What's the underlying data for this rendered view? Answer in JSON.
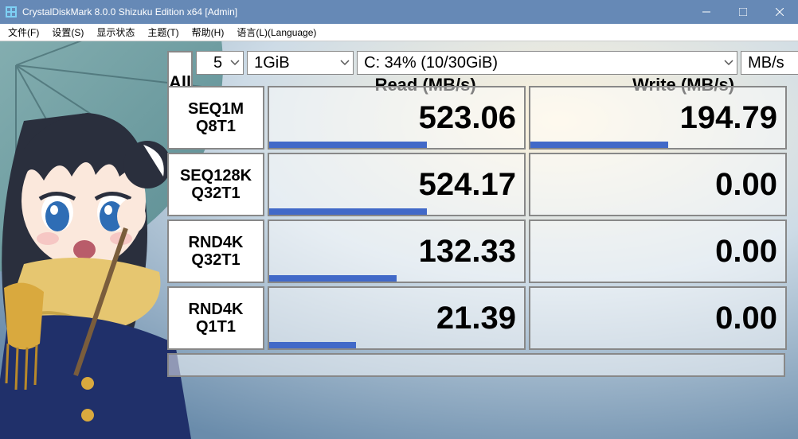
{
  "window": {
    "title": "CrystalDiskMark 8.0.0 Shizuku Edition x64 [Admin]"
  },
  "menu": {
    "file": "文件(F)",
    "settings": "设置(S)",
    "view": "显示状态",
    "theme": "主题(T)",
    "help": "帮助(H)",
    "language": "语言(L)(Language)"
  },
  "controls": {
    "all": "All",
    "count": "5",
    "size": "1GiB",
    "drive": "C: 34% (10/30GiB)",
    "unit": "MB/s"
  },
  "headers": {
    "read": "Read (MB/s)",
    "write": "Write (MB/s)"
  },
  "tests": [
    {
      "label1": "SEQ1M",
      "label2": "Q8T1",
      "read": "523.06",
      "write": "194.79",
      "rbar": 62,
      "wbar": 54
    },
    {
      "label1": "SEQ128K",
      "label2": "Q32T1",
      "read": "524.17",
      "write": "0.00",
      "rbar": 62,
      "wbar": 0
    },
    {
      "label1": "RND4K",
      "label2": "Q32T1",
      "read": "132.33",
      "write": "0.00",
      "rbar": 50,
      "wbar": 0
    },
    {
      "label1": "RND4K",
      "label2": "Q1T1",
      "read": "21.39",
      "write": "0.00",
      "rbar": 34,
      "wbar": 0
    }
  ]
}
